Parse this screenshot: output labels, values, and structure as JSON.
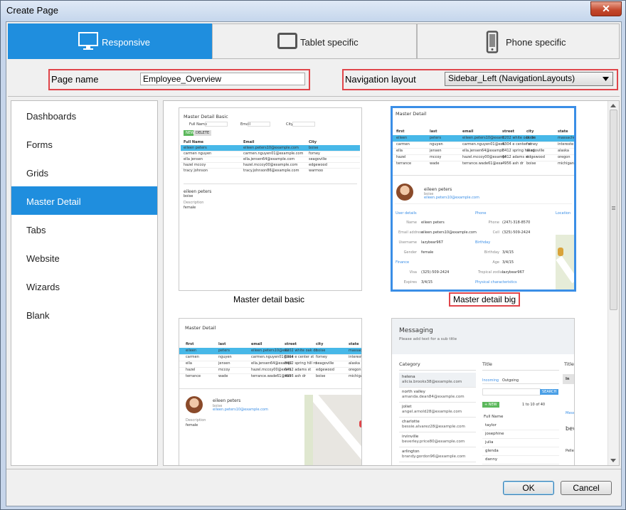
{
  "window": {
    "title": "Create Page"
  },
  "tabs": [
    {
      "label": "Responsive",
      "icon": "monitor-icon",
      "active": true
    },
    {
      "label": "Tablet specific",
      "icon": "tablet-icon",
      "active": false
    },
    {
      "label": "Phone specific",
      "icon": "phone-icon",
      "active": false
    }
  ],
  "form": {
    "page_name_label": "Page name",
    "page_name_value": "Employee_Overview",
    "nav_label": "Navigation layout",
    "nav_value": "Sidebar_Left (NavigationLayouts)"
  },
  "sidebar": {
    "items": [
      {
        "label": "Dashboards",
        "selected": false
      },
      {
        "label": "Forms",
        "selected": false
      },
      {
        "label": "Grids",
        "selected": false
      },
      {
        "label": "Master Detail",
        "selected": true
      },
      {
        "label": "Tabs",
        "selected": false
      },
      {
        "label": "Website",
        "selected": false
      },
      {
        "label": "Wizards",
        "selected": false
      },
      {
        "label": "Blank",
        "selected": false
      }
    ]
  },
  "templates": [
    {
      "caption": "Master detail  basic",
      "selected": false
    },
    {
      "caption": "Master detail  big",
      "selected": true
    },
    {
      "caption": "",
      "selected": false
    },
    {
      "caption": "",
      "selected": false
    }
  ],
  "previews": {
    "basic": {
      "title": "Master Detail Basic",
      "filters": [
        "Full Name",
        "Email",
        "City"
      ],
      "buttons": [
        "NEW",
        "DELETE"
      ],
      "headers": [
        "Full Name",
        "Email",
        "City"
      ],
      "rows": [
        [
          "eileen peters",
          "eileen.peters10@example.com",
          "boise"
        ],
        [
          "carmen nguyen",
          "carmen.nguyen01@example.com",
          "forney"
        ],
        [
          "ella jensen",
          "ella.jensen64@example.com",
          "seagoville"
        ],
        [
          "hazel mccoy",
          "hazel.mccoy00@example.com",
          "edgewood"
        ],
        [
          "tracy johnson",
          "tracy.johnson86@example.com",
          "warmoo"
        ]
      ],
      "detail_name": "eileen peters",
      "detail_city": "boise",
      "detail_desc_label": "Description",
      "detail_desc": "female"
    },
    "big": {
      "title": "Master Detail",
      "headers": [
        "first",
        "last",
        "email",
        "street",
        "city",
        "state"
      ],
      "rows": [
        [
          "eileen",
          "peters",
          "eileen.peters10@exam",
          "8202 white oak dr",
          "boise",
          "massachu"
        ],
        [
          "carmen",
          "nguyen",
          "carmen.nguyen01@exa",
          "6304 e center st",
          "forney",
          "intereste"
        ],
        [
          "ella",
          "jensen",
          "ella.jensen64@exampl",
          "8412 spring hill rd",
          "seagoville",
          "alaska"
        ],
        [
          "hazel",
          "mccoy",
          "hazel.mccoy00@exampl",
          "6412 adams st",
          "edgewood",
          "oregon"
        ],
        [
          "terrance",
          "wade",
          "terrance.wade61@exa",
          "4956 ash dr",
          "boise",
          "michigan"
        ]
      ],
      "name": "eileen peters",
      "role": "boise",
      "email": "eileen.peters10@example.com",
      "sections": [
        "User details",
        "Phone",
        "Location",
        "Finance",
        "Birthday",
        "Physical characteristics"
      ],
      "fields": [
        [
          "Name",
          "eileen peters",
          "Phone",
          "(247)-318-8570"
        ],
        [
          "Email address",
          "eileen.peters10@example.com",
          "Cell",
          "(325)-509-2424"
        ],
        [
          "Username",
          "lazybear967",
          "",
          ""
        ],
        [
          "Gender",
          "female",
          "Birthday",
          "3/4/15"
        ],
        [
          "",
          "",
          "Age",
          "3/4/15"
        ],
        [
          "Visa",
          "(325)-509-2424",
          "Tropical zodiac",
          "lazybear967"
        ],
        [
          "Expires",
          "3/4/15",
          "",
          ""
        ]
      ]
    },
    "third": {
      "title": "Master Detail",
      "headers": [
        "first",
        "last",
        "email",
        "street",
        "city",
        "state"
      ],
      "rows": [
        [
          "eileen",
          "peters",
          "eileen.peters10@exa",
          "8202 white oak dr",
          "boise",
          "massachu"
        ],
        [
          "carmen",
          "nguyen",
          "carmen.nguyen01@exa",
          "6304 e center st",
          "forney",
          "intereste"
        ],
        [
          "ella",
          "jensen",
          "ella.jensen64@exampl",
          "8412 spring hill rd",
          "seagoville",
          "alaska"
        ],
        [
          "hazel",
          "mccoy",
          "hazel.mccoy00@exam",
          "6412 adams st",
          "edgewood",
          "oregon"
        ],
        [
          "terrance",
          "wade",
          "terrance.wade61@exa",
          "4956 ash dr",
          "boise",
          "michigan"
        ]
      ],
      "name": "eileen peters",
      "role": "boise",
      "email": "eileen.peters10@example.com",
      "desc_label": "Description",
      "desc": "female"
    },
    "messaging": {
      "title": "Messaging",
      "subtitle": "Please add text for a sub title",
      "category_header": "Category",
      "title_header": "Title",
      "title_header2": "Title",
      "categories": [
        [
          "helena",
          "alicia.brooks38@example.com"
        ],
        [
          "north valley",
          "amanda.dean84@example.com"
        ],
        [
          "joliet",
          "angel.arnold28@example.com"
        ],
        [
          "charlotte",
          "bessie.alvarez28@example.com"
        ],
        [
          "irvinville",
          "beverley.price80@example.com"
        ],
        [
          "arlington",
          "brandy.gordon96@example.com"
        ]
      ],
      "tabs": [
        "Incoming",
        "Outgoing"
      ],
      "search_btn": "SEARCH",
      "new_btn": "+ NEW",
      "pager": "1 to 10 of 40",
      "fullname_header": "Full Name",
      "names": [
        "taylor",
        "josephine",
        "julia",
        "glenda",
        "danny"
      ],
      "right_snippets": [
        "In",
        "Mess",
        "bev",
        "Pelle"
      ]
    }
  },
  "footer": {
    "ok": "OK",
    "cancel": "Cancel"
  },
  "colors": {
    "accent": "#1f8ede",
    "highlight": "#e0454a",
    "row_select": "#47b8e8"
  }
}
